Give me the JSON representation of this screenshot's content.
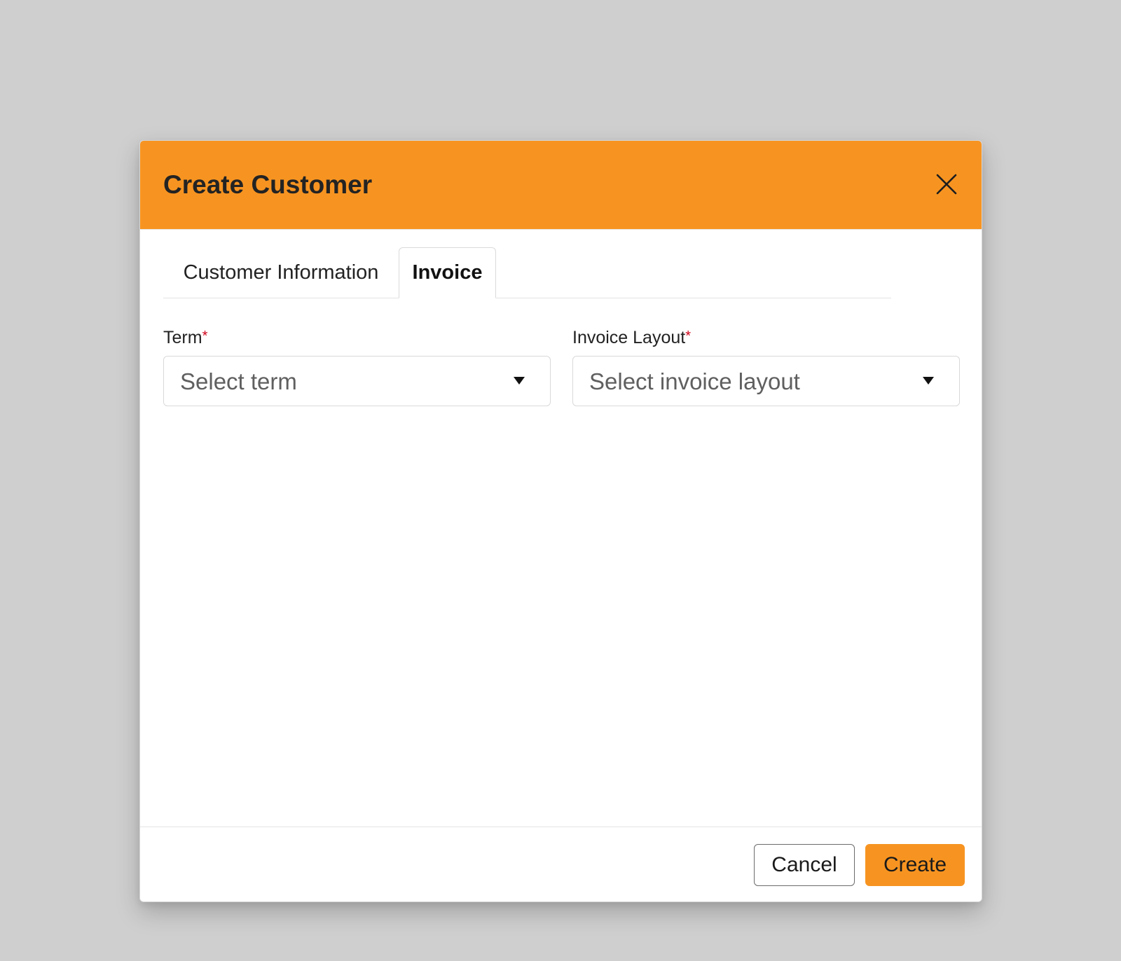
{
  "modal": {
    "title": "Create Customer",
    "close_icon": "close-icon"
  },
  "tabs": [
    {
      "label": "Customer Information",
      "active": false
    },
    {
      "label": "Invoice",
      "active": true
    }
  ],
  "form": {
    "term": {
      "label": "Term",
      "required_mark": "*",
      "placeholder": "Select term",
      "icon": "caret-down-icon"
    },
    "invoice_layout": {
      "label": "Invoice Layout",
      "required_mark": "*",
      "placeholder": "Select invoice layout",
      "icon": "caret-down-icon"
    }
  },
  "footer": {
    "cancel_label": "Cancel",
    "create_label": "Create"
  },
  "colors": {
    "accent": "#f79421",
    "required": "#d0021b",
    "backdrop": "#cfcfcf"
  }
}
